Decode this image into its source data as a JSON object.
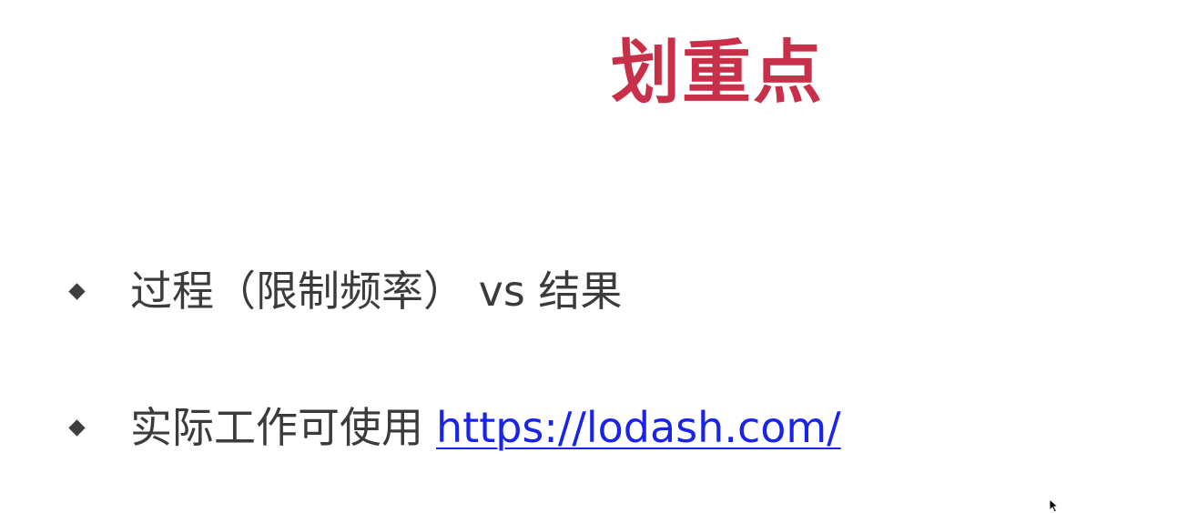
{
  "slide": {
    "title": "划重点",
    "bullets": [
      {
        "text": "过程（限制频率） vs 结果"
      },
      {
        "text": "实际工作可使用",
        "link": "https://lodash.com/"
      }
    ]
  },
  "colors": {
    "title": "#c8304a",
    "body_text": "#3b3b3b",
    "link": "#1a23e8",
    "bullet": "#3f3f3f"
  },
  "icons": {
    "bullet": "diamond-bullet-icon",
    "cursor": "mouse-pointer-icon"
  }
}
